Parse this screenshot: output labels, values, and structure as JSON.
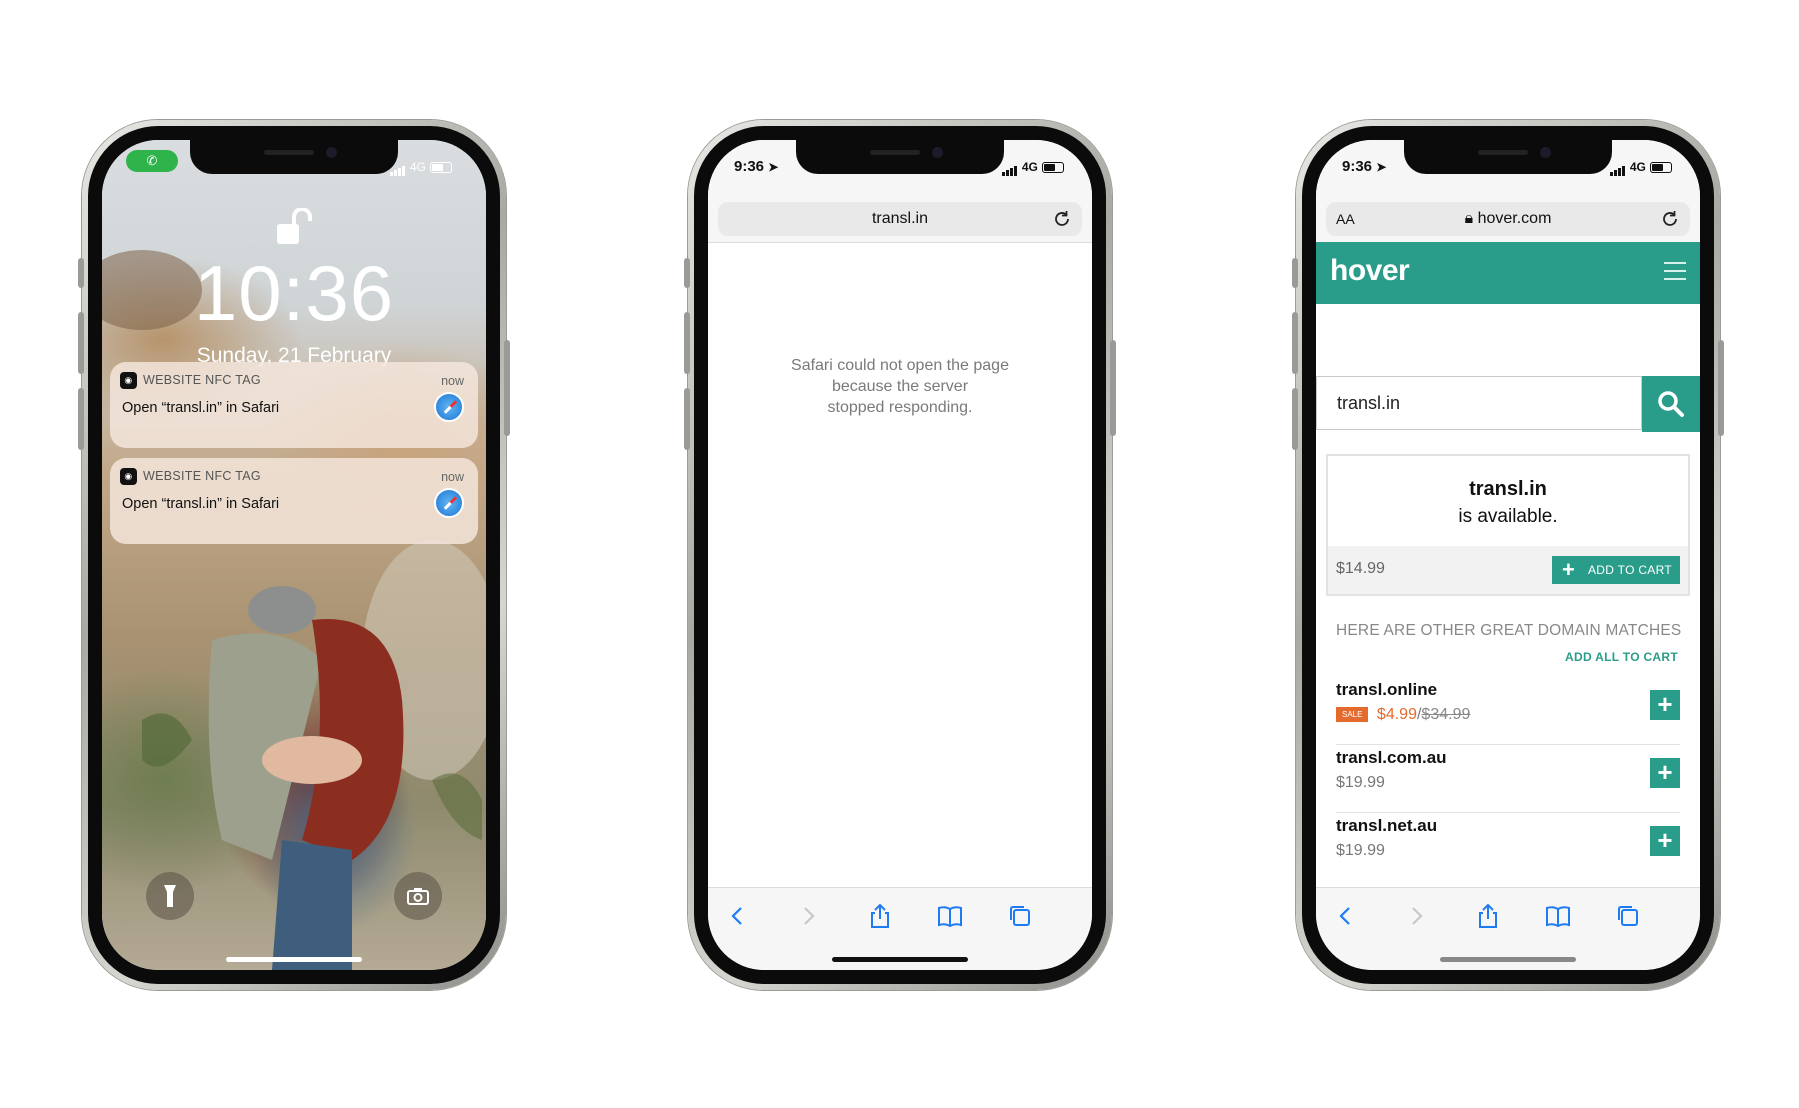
{
  "phone1": {
    "time": "10:36",
    "date": "Sunday, 21 February",
    "network": "4G",
    "notifications": [
      {
        "app": "WEBSITE NFC TAG",
        "time": "now",
        "message": "Open “transl.in” in Safari"
      },
      {
        "app": "WEBSITE NFC TAG",
        "time": "now",
        "message": "Open “transl.in” in Safari"
      }
    ]
  },
  "phone2": {
    "time": "9:36",
    "network": "4G",
    "url": "transl.in",
    "error": "Safari could not open the page because the server stopped responding.",
    "error_lines": [
      "Safari could not open the page",
      "because the server",
      "stopped responding."
    ]
  },
  "phone3": {
    "time": "9:36",
    "network": "4G",
    "aa": "AA",
    "url": "hover.com",
    "logo": "hover",
    "search_value": "transl.in",
    "available": {
      "domain": "transl.in",
      "status": "is available.",
      "price": "$14.99",
      "button": "ADD TO CART"
    },
    "matches_title": "HERE ARE OTHER GREAT DOMAIN MATCHES",
    "add_all": "ADD ALL TO CART",
    "matches": [
      {
        "name": "transl.online",
        "sale_badge": "SALE",
        "price": "$4.99",
        "separator": "/",
        "original_price": "$34.99"
      },
      {
        "name": "transl.com.au",
        "price": "$19.99"
      },
      {
        "name": "transl.net.au",
        "price": "$19.99"
      }
    ],
    "brand_color": "#2a9d8a",
    "sale_color": "#e46a2e"
  }
}
